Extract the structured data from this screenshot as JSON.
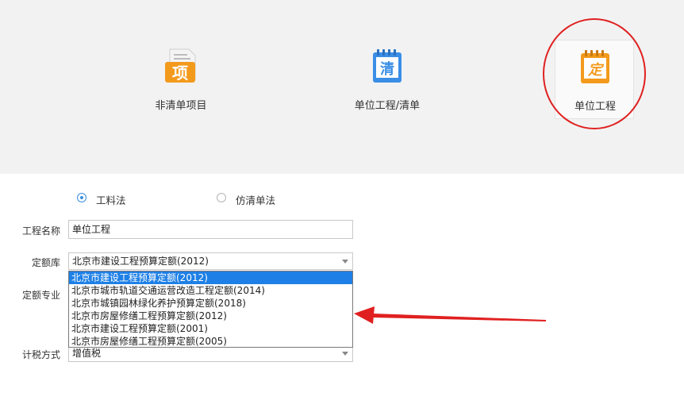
{
  "project_types": [
    {
      "label": "非清单项目",
      "badge": "项",
      "color": "#f39a1d"
    },
    {
      "label": "单位工程/清单",
      "badge": "清",
      "color": "#3a8ee6"
    },
    {
      "label": "单位工程",
      "badge": "定",
      "color": "#f39a1d"
    }
  ],
  "method": {
    "options": [
      {
        "label": "工料法",
        "checked": true
      },
      {
        "label": "仿清单法",
        "checked": false
      }
    ]
  },
  "form": {
    "name_label": "工程名称",
    "name_value": "单位工程",
    "quota_lib_label": "定额库",
    "quota_lib_value": "北京市建设工程预算定额(2012)",
    "quota_specialty_label": "定额专业",
    "tax_label": "计税方式",
    "tax_value": "增值税"
  },
  "quota_lib_options": [
    "北京市建设工程预算定额(2012)",
    "北京市城市轨道交通运营改造工程定额(2014)",
    "北京市城镇园林绿化养护预算定额(2018)",
    "北京市房屋修缮工程预算定额(2012)",
    "北京市建设工程预算定额(2001)",
    "北京市房屋修缮工程预算定额(2005)"
  ],
  "quota_lib_selected_index": 0,
  "colors": {
    "accent": "#1e80e6",
    "annotation_red": "#e02020"
  }
}
